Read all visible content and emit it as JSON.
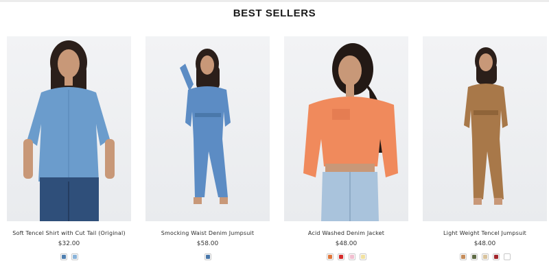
{
  "section": {
    "title": "BEST SELLERS"
  },
  "products": [
    {
      "name": "Soft Tencel Shirt with Cut Tail (Original)",
      "price": "$32.00",
      "swatches": [
        "#4f7fb0",
        "#8ab3d9"
      ],
      "garment_color": "#6b9ccc"
    },
    {
      "name": "Smocking Waist Denim Jumpsuit",
      "price": "$58.00",
      "swatches": [
        "#4a78aa"
      ],
      "garment_color": "#5c8cc4"
    },
    {
      "name": "Acid Washed Denim Jacket",
      "price": "$48.00",
      "swatches": [
        "#e0773b",
        "#d52b2b",
        "#f1bfd0",
        "#f1e1a0"
      ],
      "garment_color": "#f08a5c"
    },
    {
      "name": "Light Weight Tencel Jumpsuit",
      "price": "$48.00",
      "swatches": [
        "#c58d5b",
        "#5f6b45",
        "#d8c29c",
        "#a2262b",
        "#ffffff"
      ],
      "garment_color": "#a87849"
    }
  ]
}
